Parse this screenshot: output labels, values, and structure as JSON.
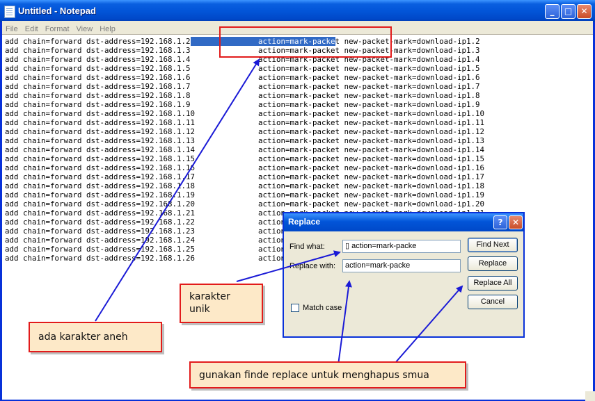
{
  "window": {
    "title": "Untitled - Notepad",
    "minimize": "_",
    "maximize": "□",
    "close": "✕"
  },
  "menu": [
    "File",
    "Edit",
    "Format",
    "View",
    "Help"
  ],
  "editor": {
    "prefix": "add chain=forward dst-address=192.168.1.",
    "action": "action=mark-packet",
    "mark_prefix": "new-packet-mark=download-ip1.",
    "rows": [
      "2",
      "3",
      "4",
      "5",
      "6",
      "7",
      "8",
      "9",
      "10",
      "11",
      "12",
      "13",
      "14",
      "15",
      "16",
      "17",
      "18",
      "19",
      "20",
      "21",
      "22",
      "23",
      "24",
      "25",
      "26"
    ]
  },
  "dialog": {
    "title": "Replace",
    "help": "?",
    "close": "✕",
    "find_label": "Find what:",
    "find_value": "▯ action=mark-packe",
    "replace_label": "Replace with:",
    "replace_value": "action=mark-packe",
    "match_case_label": "Match case",
    "find_next": "Find Next",
    "replace": "Replace",
    "replace_all": "Replace All",
    "cancel": "Cancel"
  },
  "annotations": {
    "note1": "ada karakter aneh",
    "note2": "karakter unik",
    "note3": "gunakan finde replace untuk menghapus smua"
  },
  "colors": {
    "highlight": "#316ac5",
    "annotation_border": "#e21b1b",
    "annotation_fill": "#fde9c8",
    "arrow": "#1a1ad6"
  }
}
